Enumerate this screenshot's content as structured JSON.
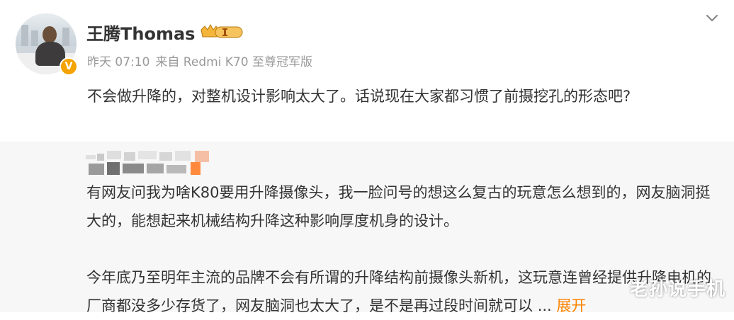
{
  "post": {
    "author": "王腾Thomas",
    "meta": {
      "time": "昨天 07:10",
      "source": "来自 Redmi K70 至尊冠军版"
    },
    "text": "不会做升降的，对整机设计影响太大了。话说现在大家都习惯了前摄挖孔的形态吧?"
  },
  "repost": {
    "paragraph1": "有网友问我为啥K80要用升降摄像头，我一脸问号的想这么复古的玩意怎么想到的，网友脑洞挺大的，能想起来机械结构升降这种影响厚度机身的设计。",
    "paragraph2": "今年底乃至明年主流的品牌不会有所谓的升降结构前摄像头新机，这玩意连曾经提供升降电机的厂商都没多少存货了，网友脑洞也太大了，是不是再过段时间就可以",
    "ellipsis": "...",
    "expand_label": "展开"
  },
  "watermark": "老孙说手机",
  "colors": {
    "accent": "#ff8200",
    "repost_bg": "#f7f7f7",
    "meta": "#999999"
  }
}
